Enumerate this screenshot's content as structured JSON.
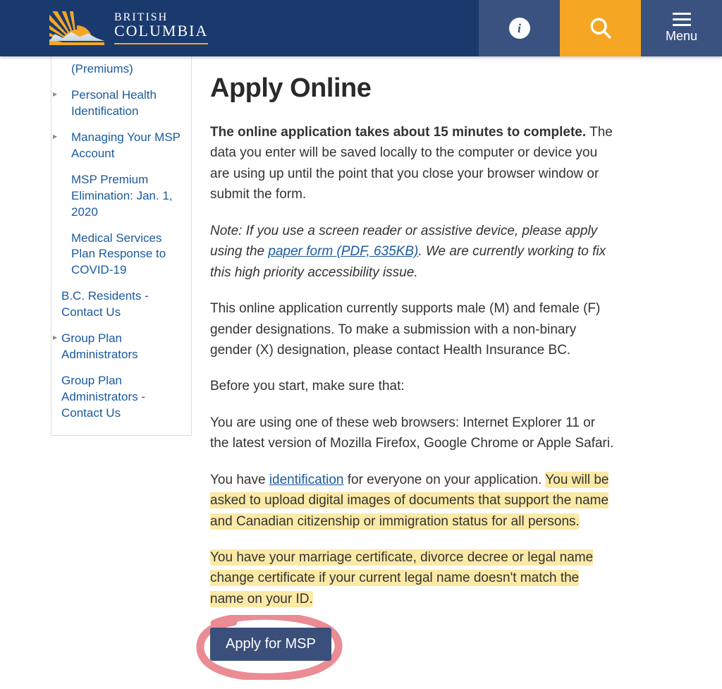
{
  "header": {
    "brand_top": "BRITISH",
    "brand_bottom": "COLUMBIA",
    "menu_label": "Menu"
  },
  "sidebar": {
    "items": [
      {
        "label": "(Premiums)",
        "indent": true,
        "caret": false
      },
      {
        "label": "Personal Health Identification",
        "indent": true,
        "caret": true
      },
      {
        "label": "Managing Your MSP Account",
        "indent": true,
        "caret": true
      },
      {
        "label": "MSP Premium Elimination: Jan. 1, 2020",
        "indent": true,
        "caret": false
      },
      {
        "label": "Medical Services Plan Response to COVID-19",
        "indent": true,
        "caret": false
      },
      {
        "label": "B.C. Residents - Contact Us",
        "indent": false,
        "caret": false
      },
      {
        "label": "Group Plan Administrators",
        "indent": false,
        "caret": true
      },
      {
        "label": "Group Plan Administrators - Contact Us",
        "indent": false,
        "caret": false
      }
    ]
  },
  "main": {
    "title": "Apply Online",
    "p1_strong": "The online application takes about 15 minutes to complete.",
    "p1_rest": " The data you enter will be saved locally to the computer or device you are using up until the point that you close your browser window or submit the form.",
    "note_prefix": "Note: If you use a screen reader or assistive device, please apply using the ",
    "note_link": "paper form (PDF, 635KB)",
    "note_suffix": ". We are currently working to fix this high priority accessibility issue.",
    "p3": "This online application currently supports male (M) and female (F) gender designations. To make a submission with a non-binary gender (X) designation, please contact Health Insurance BC.",
    "p4": "Before you start, make sure that:",
    "p5": "You are using one of these web browsers: Internet Explorer 11 or the latest version of Mozilla Firefox, Google Chrome or Apple Safari.",
    "p6_a": "You have ",
    "p6_link": "identification",
    "p6_b": " for everyone on your application. ",
    "p6_hl": "You will be asked to upload digital images of documents that support the name and Canadian citizenship or immigration status for all persons.",
    "p7_hl": "You have your marriage certificate, divorce decree or legal name change certificate if your current legal name doesn't match the name on your ID.",
    "apply_button": "Apply for MSP"
  }
}
